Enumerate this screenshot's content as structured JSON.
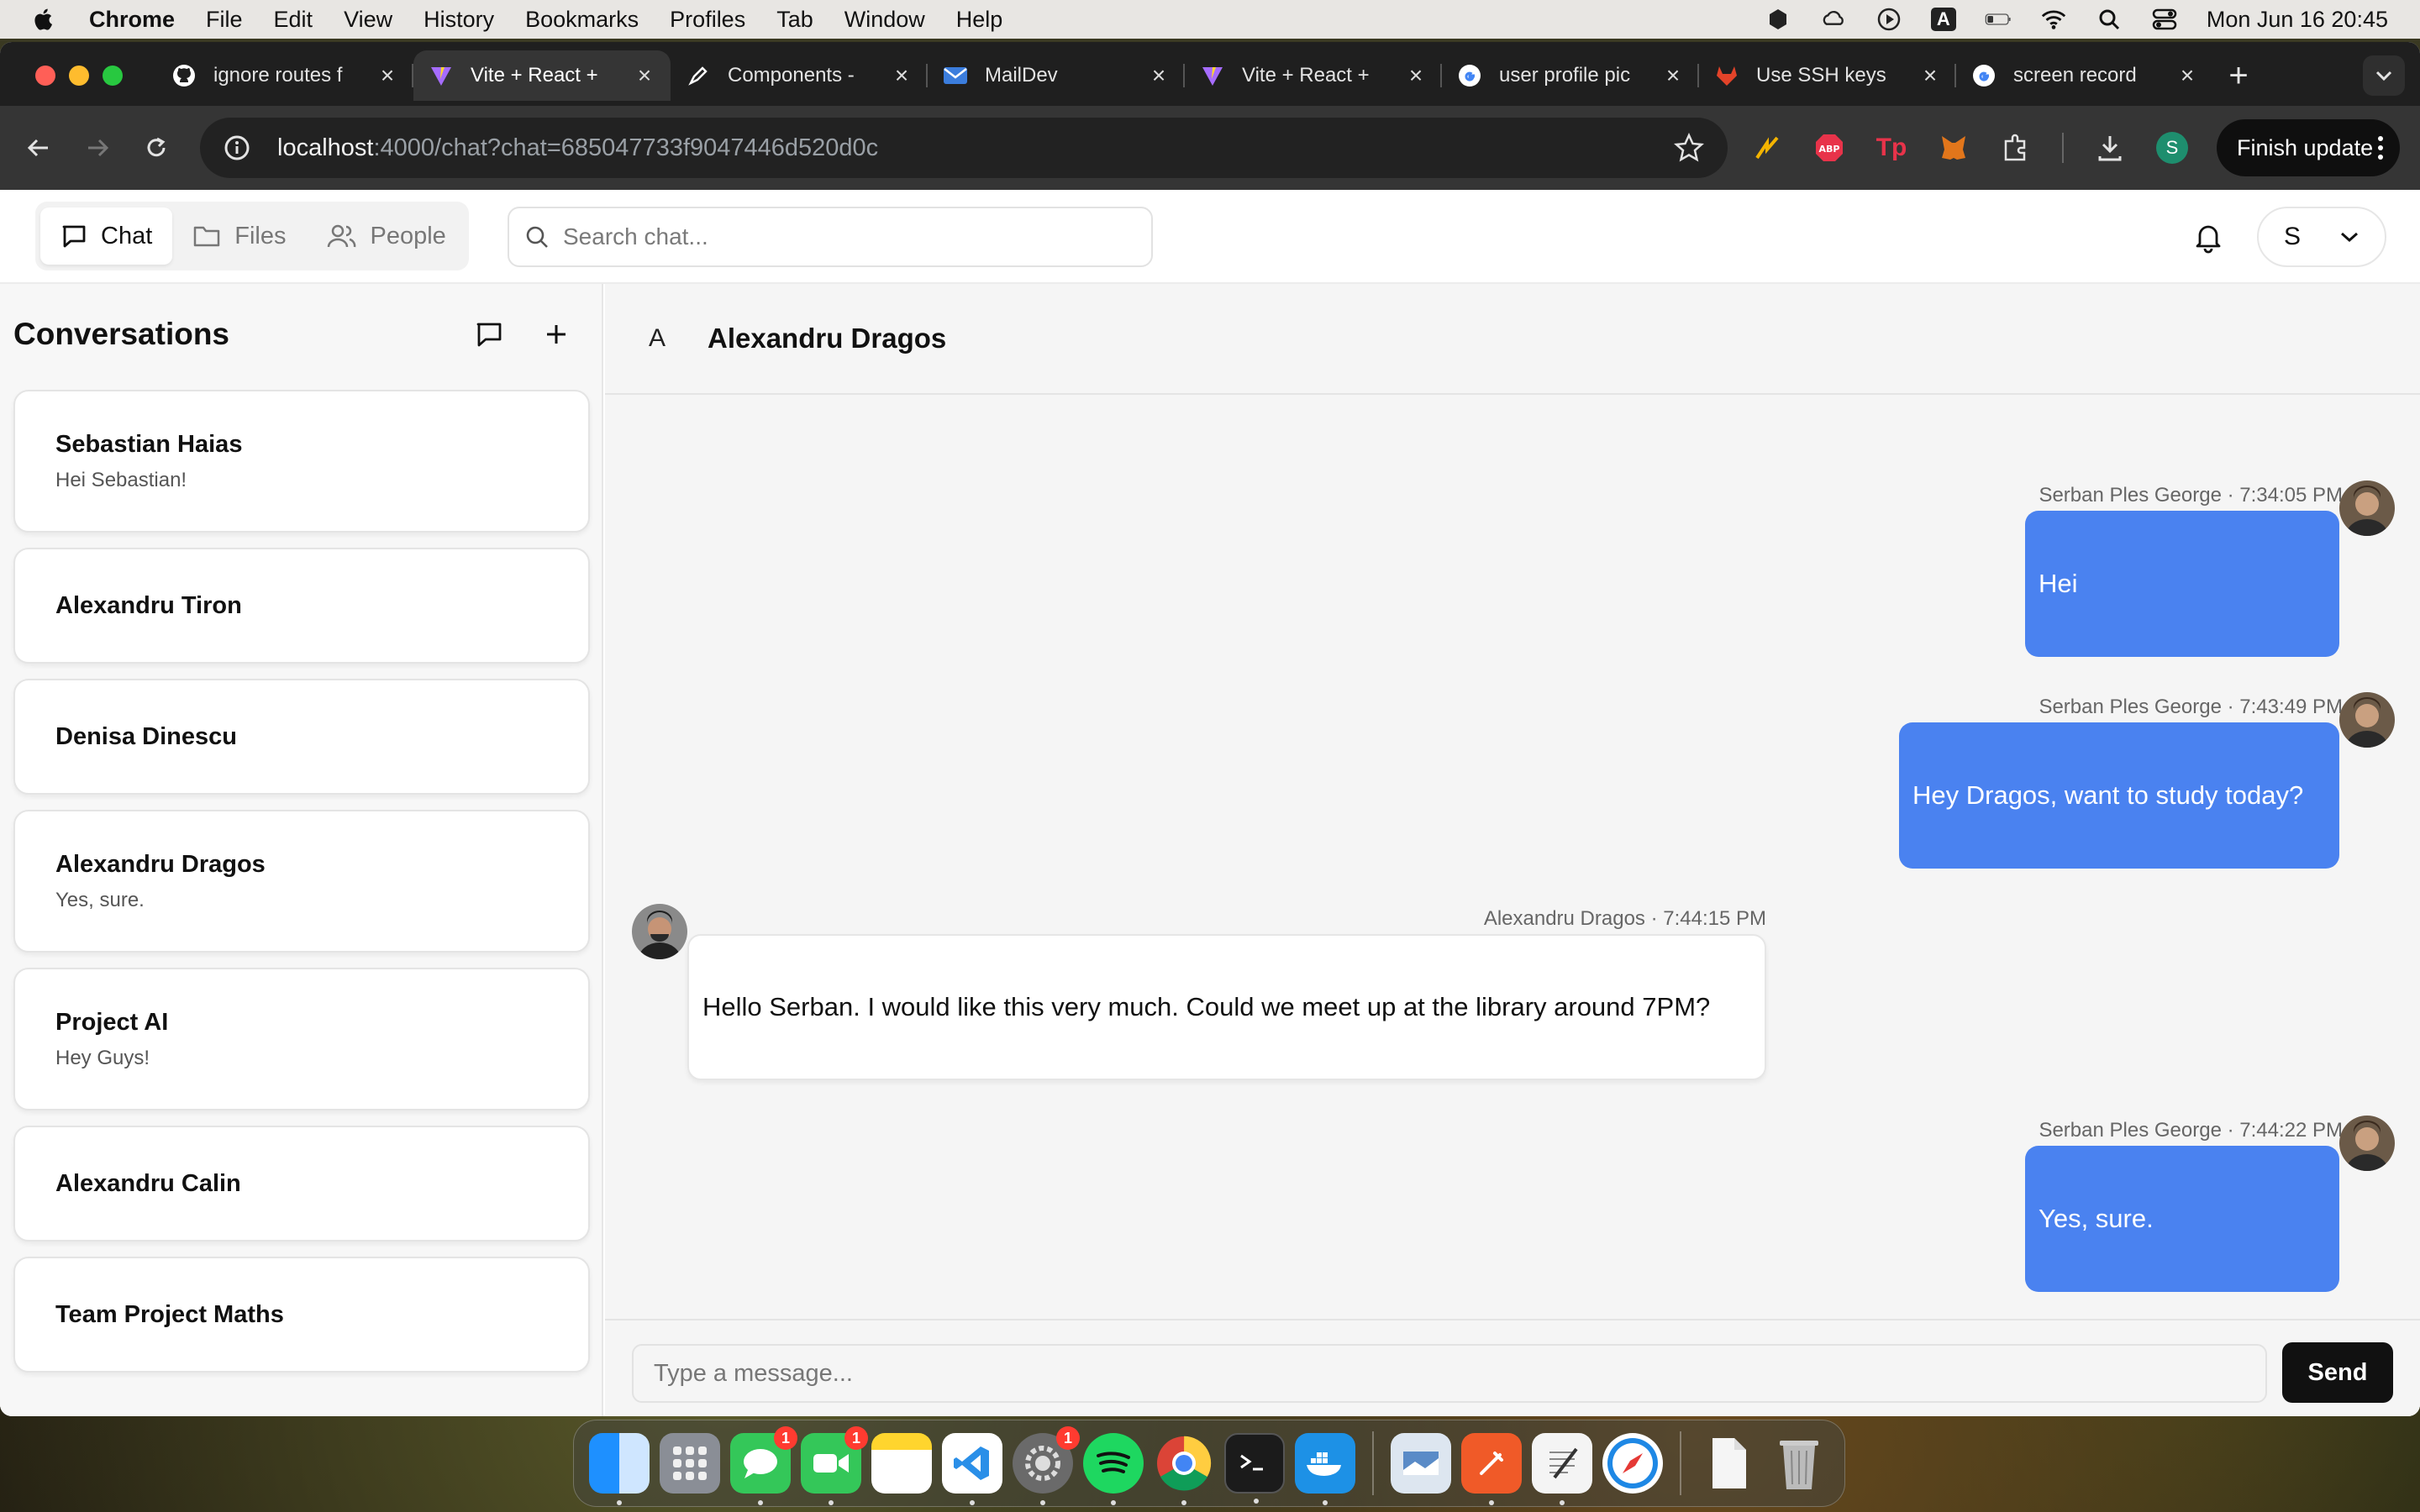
{
  "menubar": {
    "app": "Chrome",
    "items": [
      "File",
      "Edit",
      "View",
      "History",
      "Bookmarks",
      "Profiles",
      "Tab",
      "Window",
      "Help"
    ],
    "input_source": "A",
    "clock": "Mon Jun 16  20:45"
  },
  "browser": {
    "tabs": [
      {
        "title": "ignore routes f",
        "icon": "github-icon"
      },
      {
        "title": "Vite + React +",
        "icon": "vite-icon"
      },
      {
        "title": "Components -",
        "icon": "pen-icon"
      },
      {
        "title": "MailDev",
        "icon": "mail-icon"
      },
      {
        "title": "Vite + React +",
        "icon": "vite-icon"
      },
      {
        "title": "user profile pic",
        "icon": "google-icon"
      },
      {
        "title": "Use SSH keys",
        "icon": "gitlab-icon"
      },
      {
        "title": "screen record",
        "icon": "google-icon"
      }
    ],
    "url_host": "localhost",
    "url_path": ":4000/chat?chat=685047733f9047446d520d0c",
    "profile_initial": "S",
    "finish_update": "Finish update"
  },
  "app": {
    "nav": {
      "chat": "Chat",
      "files": "Files",
      "people": "People"
    },
    "search_placeholder": "Search chat...",
    "user_initial": "S"
  },
  "sidebar": {
    "title": "Conversations",
    "conversations": [
      {
        "name": "Sebastian Haias",
        "preview": "Hei Sebastian!"
      },
      {
        "name": "Alexandru Tiron",
        "preview": ""
      },
      {
        "name": "Denisa Dinescu",
        "preview": ""
      },
      {
        "name": "Alexandru Dragos",
        "preview": "Yes, sure."
      },
      {
        "name": "Project AI",
        "preview": "Hey Guys!"
      },
      {
        "name": "Alexandru Calin",
        "preview": ""
      },
      {
        "name": "Team Project Maths",
        "preview": ""
      }
    ]
  },
  "chat": {
    "avatar_letter": "A",
    "title": "Alexandru Dragos",
    "messages": [
      {
        "meta": "Serban Ples George · 7:34:05 PM",
        "text": "Hei"
      },
      {
        "meta": "Serban Ples George · 7:43:49 PM",
        "text": "Hey Dragos, want to study today?"
      },
      {
        "meta": "Alexandru Dragos · 7:44:15 PM",
        "text": "Hello Serban. I would like this very much. Could we meet up at the library around 7PM?"
      },
      {
        "meta": "Serban Ples George · 7:44:22 PM",
        "text": "Yes, sure."
      }
    ],
    "composer_placeholder": "Type a message...",
    "send_label": "Send"
  },
  "dock": {
    "messages_badge": "1",
    "facetime_badge": "1",
    "settings_badge": "1"
  }
}
